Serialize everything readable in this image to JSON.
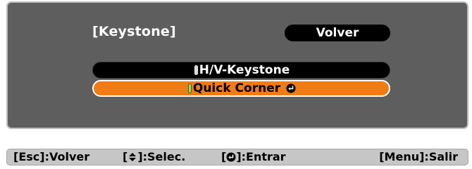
{
  "menu": {
    "title": "[Keystone]",
    "back_button_label": "Volver",
    "options": [
      {
        "label": "H/V-Keystone",
        "selected": false
      },
      {
        "label": "Quick Corner",
        "selected": true
      }
    ],
    "colors": {
      "panel": "#5e5e5e",
      "selected_option": "#f07c16",
      "unselected_option": "#000000"
    }
  },
  "help_bar": {
    "esc": {
      "key": "[Esc]",
      "action": ":Volver"
    },
    "select": {
      "key_open": "[",
      "key_icon": "up-down-arrow-icon",
      "key_close": "]",
      "action": ":Selec."
    },
    "enter": {
      "key_open": "[",
      "key_icon": "enter-icon",
      "key_close": "]",
      "action": ":Entrar"
    },
    "menu": {
      "key": "[Menu]",
      "action": ":Salir"
    }
  }
}
